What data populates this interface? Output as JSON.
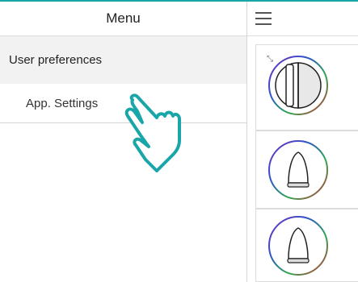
{
  "menu": {
    "title": "Menu",
    "section_title": "User preferences",
    "items": [
      {
        "label": "App. Settings"
      }
    ]
  },
  "right": {
    "menu_icon": "hamburger-menu-icon",
    "devices": [
      {
        "icon": "device-detail-icon",
        "secondary_icon": "collapse-icon"
      },
      {
        "icon": "bell-device-icon"
      },
      {
        "icon": "bell-device-icon"
      }
    ]
  },
  "colors": {
    "accent": "#1aa6a8",
    "ring_purple": "#7a2bbf",
    "ring_green": "#2fa84f",
    "ring_red": "#d62f3a",
    "ring_blue": "#2c56c9"
  },
  "overlay": {
    "icon": "hand-pointer-icon"
  }
}
